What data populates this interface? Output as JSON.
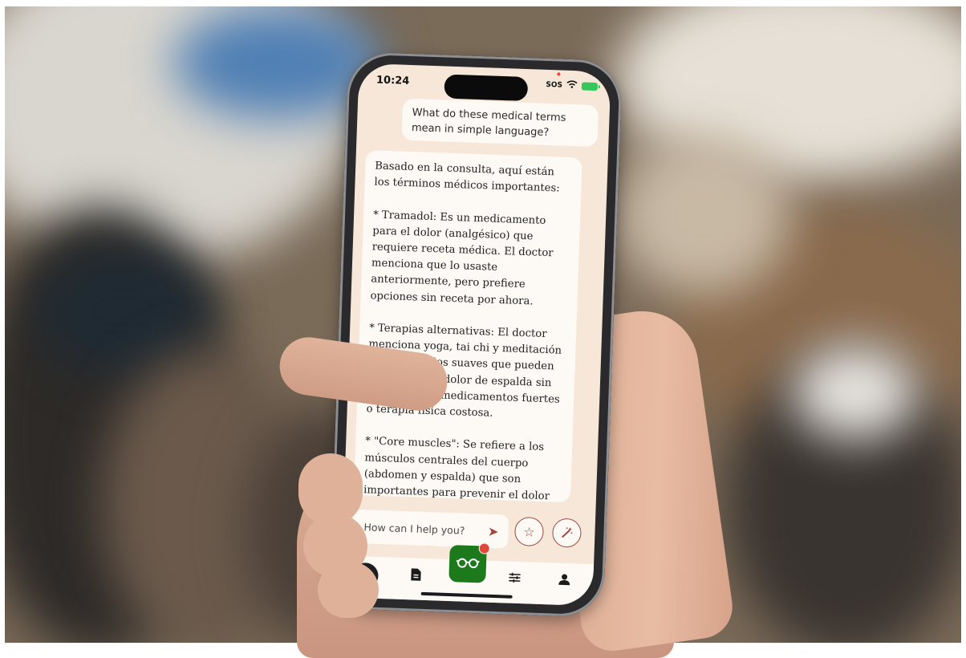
{
  "status_bar": {
    "time": "10:24",
    "sos": "SOS",
    "wifi_icon": "wifi-icon",
    "battery_icon": "battery-charging-icon"
  },
  "chat": {
    "user_message": "What do these medical terms mean in simple language?",
    "assistant_message": "Basado en la consulta, aquí están los términos médicos importantes:\n\n* Tramadol: Es un medicamento para el dolor (analgésico) que requiere receta médica. El doctor menciona que lo usaste anteriormente, pero prefiere opciones sin receta por ahora.\n\n* Terapias alternativas: El doctor menciona yoga, tai chi y meditación - son ejercicios suaves que pueden ayudar con el dolor de espalda sin necesidad de medicamentos fuertes o terapia física costosa.\n\n* \"Core muscles\": Se refiere a los músculos centrales del cuerpo (abdomen y espalda) que son importantes para prevenir el dolor de espalda recurrente."
  },
  "composer": {
    "placeholder": "How can I help you?",
    "send_icon": "send-icon",
    "star_icon": "star-icon",
    "wand_icon": "magic-wand-icon"
  },
  "nav": {
    "chat_icon": "chat-icon",
    "document_icon": "document-icon",
    "center_icon": "glasses-icon",
    "sliders_icon": "sliders-icon",
    "profile_icon": "profile-icon"
  },
  "colors": {
    "accent": "#a0453a",
    "brand_green": "#1c7a1c",
    "screen_bg": "#f6e7d8",
    "badge": "#e0483e"
  }
}
